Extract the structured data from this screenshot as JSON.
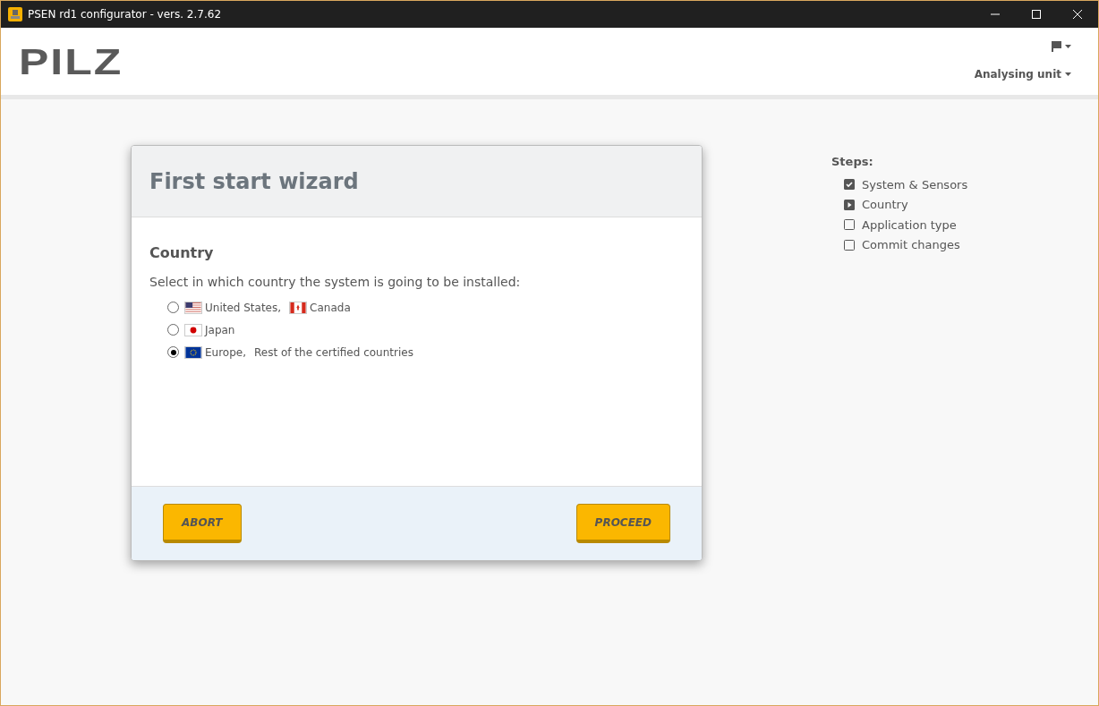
{
  "window": {
    "title": "PSEN rd1 configurator - vers. 2.7.62"
  },
  "header": {
    "logo": "PILZ",
    "menu": "Analysing unit"
  },
  "wizard": {
    "title": "First start wizard",
    "section": "Country",
    "prompt": "Select in which country the system is going to be installed:",
    "options": [
      {
        "selected": false,
        "parts": [
          {
            "kind": "us",
            "label": "United States,"
          },
          {
            "kind": "ca",
            "label": "Canada"
          }
        ]
      },
      {
        "selected": false,
        "parts": [
          {
            "kind": "jp",
            "label": "Japan"
          }
        ]
      },
      {
        "selected": true,
        "parts": [
          {
            "kind": "eu",
            "label": "Europe,"
          },
          {
            "kind": "text",
            "label": "Rest of the certified countries"
          }
        ]
      }
    ],
    "buttons": [
      "ABORT",
      "PROCEED"
    ]
  },
  "steps": {
    "title": "Steps:",
    "items": [
      {
        "label": "System & Sensors",
        "kind": "done"
      },
      {
        "label": "Country",
        "kind": "current"
      },
      {
        "label": "Application type",
        "kind": "pending"
      },
      {
        "label": "Commit changes",
        "kind": "pending"
      }
    ]
  }
}
